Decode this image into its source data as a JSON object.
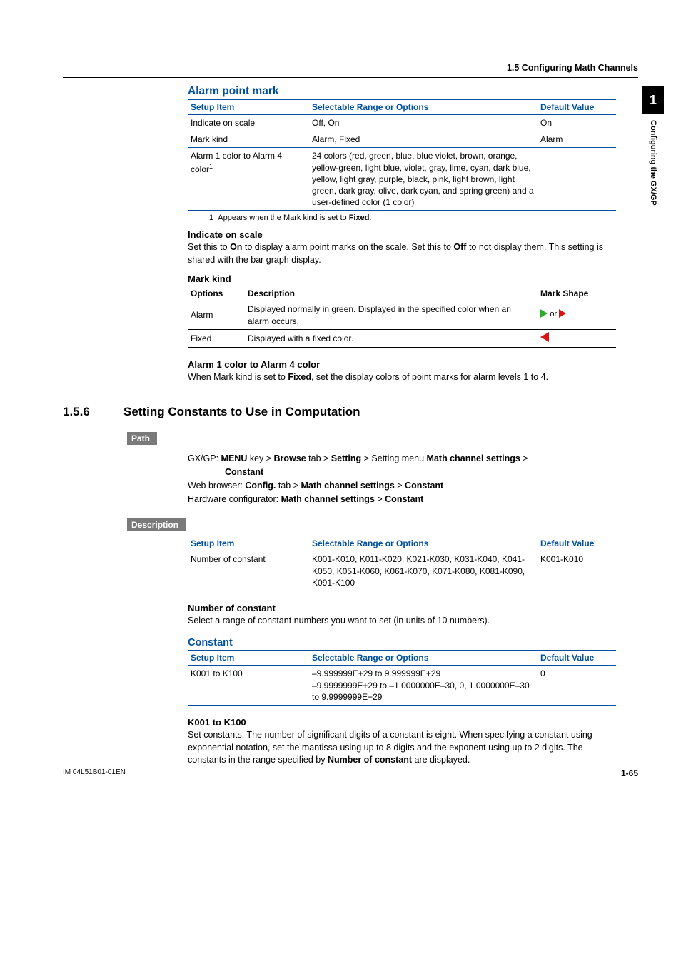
{
  "header": {
    "breadcrumb": "1.5  Configuring Math Channels"
  },
  "sidetab": {
    "num": "1",
    "text": "Configuring the GX/GP"
  },
  "alarm": {
    "title": "Alarm point mark",
    "cols": {
      "c1": "Setup Item",
      "c2": "Selectable Range or Options",
      "c3": "Default Value"
    },
    "rows": [
      {
        "c1": "Indicate on scale",
        "c2": "Off, On",
        "c3": "On"
      },
      {
        "c1": "Mark kind",
        "c2": "Alarm, Fixed",
        "c3": "Alarm"
      },
      {
        "c1": "Alarm 1 color to Alarm 4 color",
        "sup": "1",
        "c2": "24 colors (red, green, blue, blue violet, brown, orange, yellow-green, light blue, violet, gray, lime, cyan, dark blue, yellow, light gray, purple, black, pink, light brown, light green, dark gray, olive, dark cyan, and spring green) and a user-defined color (1 color)",
        "c3": ""
      }
    ],
    "footnote_num": "1",
    "footnote_a": "Appears when the Mark kind is set to ",
    "footnote_b": "Fixed",
    "footnote_c": "."
  },
  "indicate": {
    "title": "Indicate on scale",
    "p1a": "Set this to ",
    "p1b": "On",
    "p1c": " to display alarm point marks on the scale. Set this to ",
    "p1d": "Off",
    "p1e": " to not display them. This setting is shared with the bar graph display."
  },
  "markkind": {
    "title": "Mark kind",
    "cols": {
      "c1": "Options",
      "c2": "Description",
      "c3": "Mark Shape"
    },
    "rows": [
      {
        "c1": "Alarm",
        "c2": "Displayed normally in green. Displayed in the specified color when an alarm occurs.",
        "or": "or"
      },
      {
        "c1": "Fixed",
        "c2": "Displayed with a fixed color."
      }
    ]
  },
  "alarmcolor": {
    "title": "Alarm 1 color to Alarm 4 color",
    "p_a": "When Mark kind is set to ",
    "p_b": "Fixed",
    "p_c": ", set the display colors of point marks for alarm levels 1 to 4."
  },
  "sec": {
    "num": "1.5.6",
    "title": "Setting Constants to Use in Computation"
  },
  "path": {
    "label": "Path",
    "l1a": "GX/GP: ",
    "l1b": "MENU",
    "l1c": " key > ",
    "l1d": "Browse",
    "l1e": " tab > ",
    "l1f": "Setting",
    "l1g": " > Setting menu ",
    "l1h": "Math channel settings",
    "l1i": " > ",
    "l2a": "Constant",
    "l3a": "Web browser: ",
    "l3b": "Config.",
    "l3c": " tab > ",
    "l3d": "Math channel settings",
    "l3e": " > ",
    "l3f": "Constant",
    "l4a": "Hardware configurator: ",
    "l4b": "Math channel settings",
    "l4c": " > ",
    "l4d": "Constant"
  },
  "desc": {
    "label": "Description",
    "cols": {
      "c1": "Setup Item",
      "c2": "Selectable Range or Options",
      "c3": "Default Value"
    },
    "rows": [
      {
        "c1": "Number of constant",
        "c2": "K001-K010, K011-K020, K021-K030, K031-K040, K041-K050, K051-K060, K061-K070, K071-K080, K081-K090, K091-K100",
        "c3": "K001-K010"
      }
    ]
  },
  "numconst": {
    "title": "Number of constant",
    "p": "Select a range of constant numbers you want to set (in units of 10 numbers)."
  },
  "constant": {
    "title": "Constant",
    "cols": {
      "c1": "Setup Item",
      "c2": "Selectable Range or Options",
      "c3": "Default Value"
    },
    "rows": [
      {
        "c1": "K001 to K100",
        "c2": "–9.999999E+29 to 9.999999E+29\n–9.9999999E+29 to –1.0000000E–30, 0, 1.0000000E–30 to 9.9999999E+29",
        "c3": "0"
      }
    ]
  },
  "k001": {
    "title": "K001 to K100",
    "p_a": "Set constants. The number of significant digits of a constant is eight. When specifying a constant using exponential notation, set the mantissa using up to 8 digits and the exponent using up to 2 digits. The constants in the range specified by ",
    "p_b": "Number of constant",
    "p_c": " are displayed."
  },
  "footer": {
    "left": "IM 04L51B01-01EN",
    "right": "1-65"
  }
}
